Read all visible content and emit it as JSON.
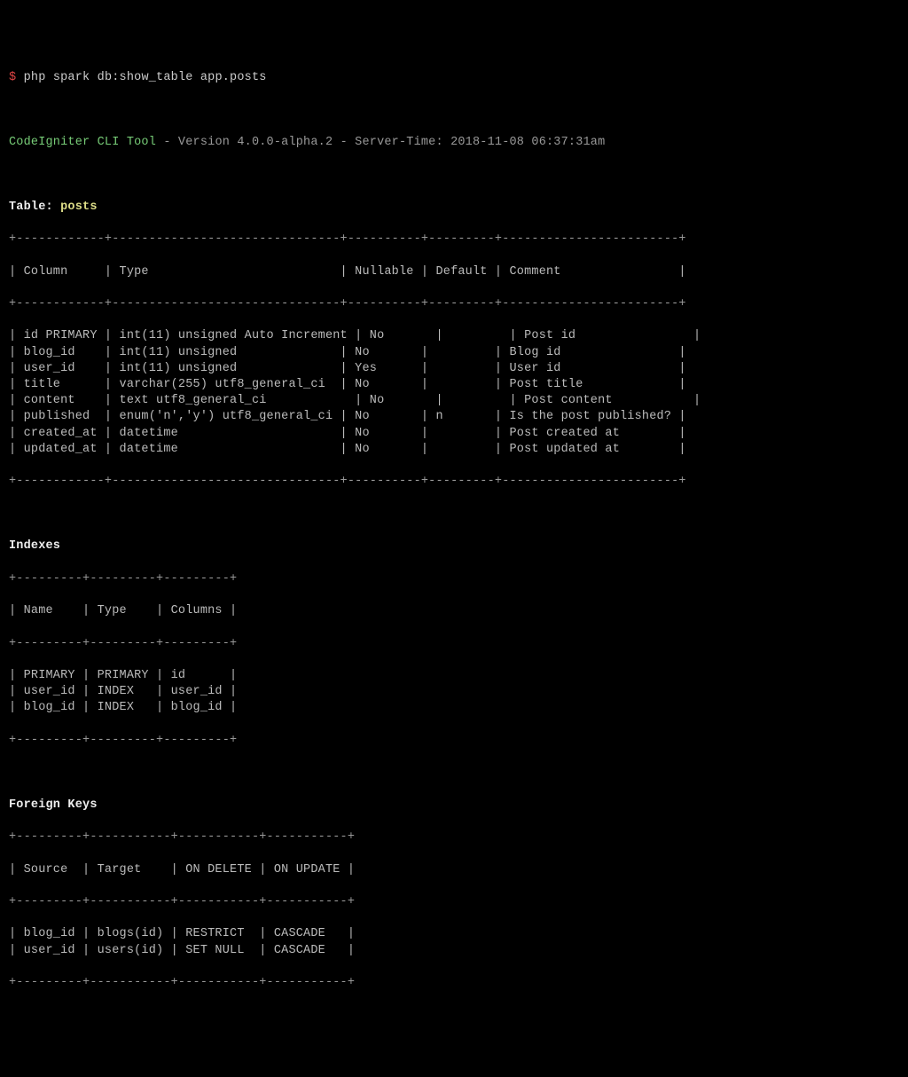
{
  "prompt_symbol": "$",
  "command": "php spark db:show_table app.posts",
  "tool_name": "CodeIgniter CLI Tool",
  "tool_info": " - Version 4.0.0-alpha.2 - Server-Time: 2018-11-08 06:37:31am",
  "table_label": "Table: ",
  "table_name": "posts",
  "columns_header_line": "| Column     | Type                          | Nullable | Default | Comment                |",
  "columns_sep": "+------------+-------------------------------+----------+---------+------------------------+",
  "columns_rows": [
    "| id PRIMARY | int(11) unsigned Auto Increment | No       |         | Post id                |",
    "| blog_id    | int(11) unsigned              | No       |         | Blog id                |",
    "| user_id    | int(11) unsigned              | Yes      |         | User id                |",
    "| title      | varchar(255) utf8_general_ci  | No       |         | Post title             |",
    "| content    | text utf8_general_ci            | No       |         | Post content           |",
    "| published  | enum('n','y') utf8_general_ci | No       | n       | Is the post published? |",
    "| created_at | datetime                      | No       |         | Post created at        |",
    "| updated_at | datetime                      | No       |         | Post updated at        |"
  ],
  "indexes_label": "Indexes",
  "indexes_sep": "+---------+---------+---------+",
  "indexes_header": "| Name    | Type    | Columns |",
  "indexes_rows": [
    "| PRIMARY | PRIMARY | id      |",
    "| user_id | INDEX   | user_id |",
    "| blog_id | INDEX   | blog_id |"
  ],
  "fks_label": "Foreign Keys",
  "fks_sep": "+---------+-----------+-----------+-----------+",
  "fks_header": "| Source  | Target    | ON DELETE | ON UPDATE |",
  "fks_rows": [
    "| blog_id | blogs(id) | RESTRICT  | CASCADE   |",
    "| user_id | users(id) | SET NULL  | CASCADE   |"
  ],
  "chart_data": {
    "type": "table",
    "title": "posts",
    "columns": [
      {
        "name": "id",
        "primary": true,
        "type": "int(11) unsigned",
        "auto_increment": true,
        "nullable": "No",
        "default": "",
        "comment": "Post id"
      },
      {
        "name": "blog_id",
        "type": "int(11) unsigned",
        "nullable": "No",
        "default": "",
        "comment": "Blog id"
      },
      {
        "name": "user_id",
        "type": "int(11) unsigned",
        "nullable": "Yes",
        "default": "",
        "comment": "User id"
      },
      {
        "name": "title",
        "type": "varchar(255) utf8_general_ci",
        "nullable": "No",
        "default": "",
        "comment": "Post title"
      },
      {
        "name": "content",
        "type": "text utf8_general_ci",
        "nullable": "No",
        "default": "",
        "comment": "Post content"
      },
      {
        "name": "published",
        "type": "enum('n','y') utf8_general_ci",
        "nullable": "No",
        "default": "n",
        "comment": "Is the post published?"
      },
      {
        "name": "created_at",
        "type": "datetime",
        "nullable": "No",
        "default": "",
        "comment": "Post created at"
      },
      {
        "name": "updated_at",
        "type": "datetime",
        "nullable": "No",
        "default": "",
        "comment": "Post updated at"
      }
    ],
    "indexes": [
      {
        "name": "PRIMARY",
        "type": "PRIMARY",
        "columns": "id"
      },
      {
        "name": "user_id",
        "type": "INDEX",
        "columns": "user_id"
      },
      {
        "name": "blog_id",
        "type": "INDEX",
        "columns": "blog_id"
      }
    ],
    "foreign_keys": [
      {
        "source": "blog_id",
        "target": "blogs(id)",
        "on_delete": "RESTRICT",
        "on_update": "CASCADE"
      },
      {
        "source": "user_id",
        "target": "users(id)",
        "on_delete": "SET NULL",
        "on_update": "CASCADE"
      }
    ]
  }
}
